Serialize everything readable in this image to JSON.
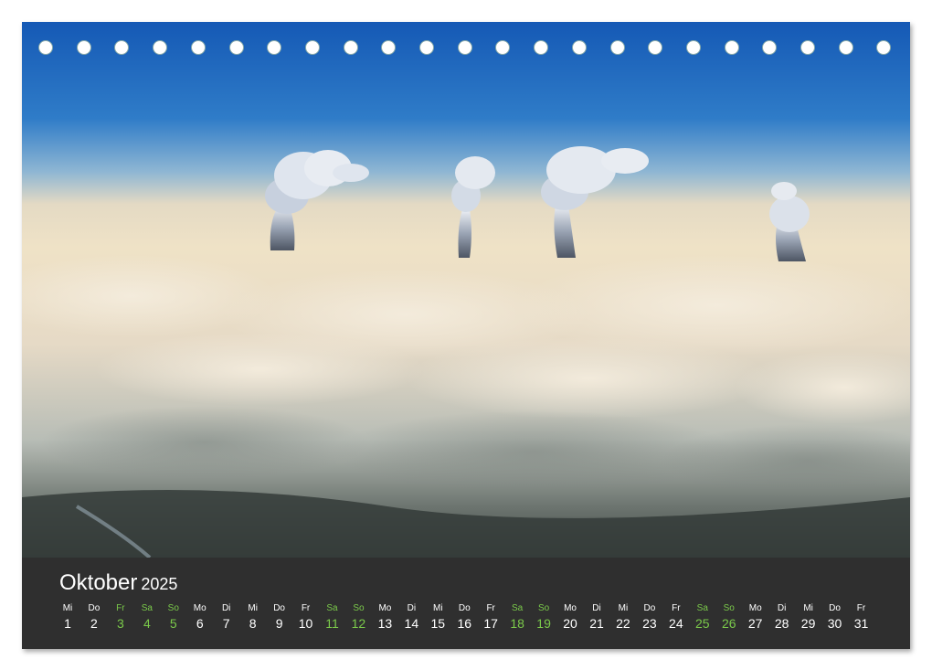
{
  "calendar": {
    "month": "Oktober",
    "year": "2025",
    "weekend_color": "#7ac94a",
    "days": [
      {
        "wd": "Mi",
        "n": "1",
        "we": false
      },
      {
        "wd": "Do",
        "n": "2",
        "we": false
      },
      {
        "wd": "Fr",
        "n": "3",
        "we": true
      },
      {
        "wd": "Sa",
        "n": "4",
        "we": true
      },
      {
        "wd": "So",
        "n": "5",
        "we": true
      },
      {
        "wd": "Mo",
        "n": "6",
        "we": false
      },
      {
        "wd": "Di",
        "n": "7",
        "we": false
      },
      {
        "wd": "Mi",
        "n": "8",
        "we": false
      },
      {
        "wd": "Do",
        "n": "9",
        "we": false
      },
      {
        "wd": "Fr",
        "n": "10",
        "we": false
      },
      {
        "wd": "Sa",
        "n": "11",
        "we": true
      },
      {
        "wd": "So",
        "n": "12",
        "we": true
      },
      {
        "wd": "Mo",
        "n": "13",
        "we": false
      },
      {
        "wd": "Di",
        "n": "14",
        "we": false
      },
      {
        "wd": "Mi",
        "n": "15",
        "we": false
      },
      {
        "wd": "Do",
        "n": "16",
        "we": false
      },
      {
        "wd": "Fr",
        "n": "17",
        "we": false
      },
      {
        "wd": "Sa",
        "n": "18",
        "we": true
      },
      {
        "wd": "So",
        "n": "19",
        "we": true
      },
      {
        "wd": "Mo",
        "n": "20",
        "we": false
      },
      {
        "wd": "Di",
        "n": "21",
        "we": false
      },
      {
        "wd": "Mi",
        "n": "22",
        "we": false
      },
      {
        "wd": "Do",
        "n": "23",
        "we": false
      },
      {
        "wd": "Fr",
        "n": "24",
        "we": false
      },
      {
        "wd": "Sa",
        "n": "25",
        "we": true
      },
      {
        "wd": "So",
        "n": "26",
        "we": true
      },
      {
        "wd": "Mo",
        "n": "27",
        "we": false
      },
      {
        "wd": "Di",
        "n": "28",
        "we": false
      },
      {
        "wd": "Mi",
        "n": "29",
        "we": false
      },
      {
        "wd": "Do",
        "n": "30",
        "we": false
      },
      {
        "wd": "Fr",
        "n": "31",
        "we": false
      }
    ]
  },
  "photo": {
    "subject": "cooling-tower-plumes-above-clouds",
    "sky_top_color": "#1a5fb8",
    "sky_horizon_color": "#e9d8b8",
    "cloud_color": "#efe3cc"
  }
}
